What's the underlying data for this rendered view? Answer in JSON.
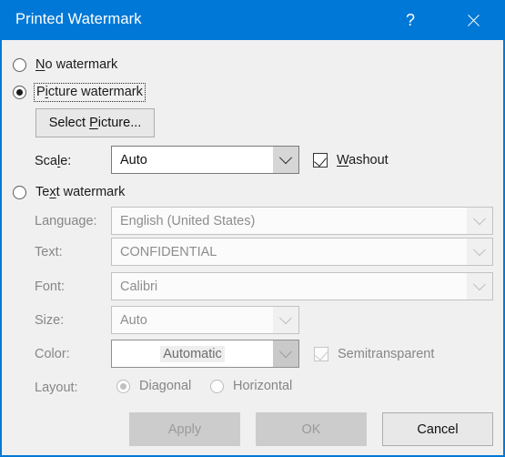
{
  "window": {
    "title": "Printed Watermark",
    "help_icon": "question-mark-icon",
    "close_icon": "close-icon",
    "accent_color": "#0078d7",
    "background_color": "#f0f0f0"
  },
  "options": {
    "no_watermark": {
      "label": "No watermark",
      "accel": "N",
      "selected": false
    },
    "picture_watermark": {
      "label": "Picture watermark",
      "accel": "P",
      "selected": true,
      "focused": true
    },
    "text_watermark": {
      "label": "Text watermark",
      "accel": "x",
      "selected": false
    }
  },
  "picture_section": {
    "select_picture_button": "Select Picture...",
    "select_picture_accel": "P",
    "scale_label": "Scale:",
    "scale_value": "Auto",
    "washout_label": "Washout",
    "washout_accel": "W",
    "washout_checked": true
  },
  "text_section": {
    "language_label": "Language:",
    "language_value": "English (United States)",
    "text_label": "Text:",
    "text_value": "CONFIDENTIAL",
    "font_label": "Font:",
    "font_value": "Calibri",
    "size_label": "Size:",
    "size_value": "Auto",
    "color_label": "Color:",
    "color_value": "Automatic",
    "semitransparent_label": "Semitransparent",
    "semitransparent_checked": true,
    "layout_label": "Layout:",
    "layout_diagonal": "Diagonal",
    "layout_horizontal": "Horizontal",
    "layout_selected": "Diagonal"
  },
  "footer": {
    "apply_label": "Apply",
    "apply_enabled": false,
    "ok_label": "OK",
    "ok_enabled": false,
    "cancel_label": "Cancel",
    "cancel_enabled": true
  }
}
